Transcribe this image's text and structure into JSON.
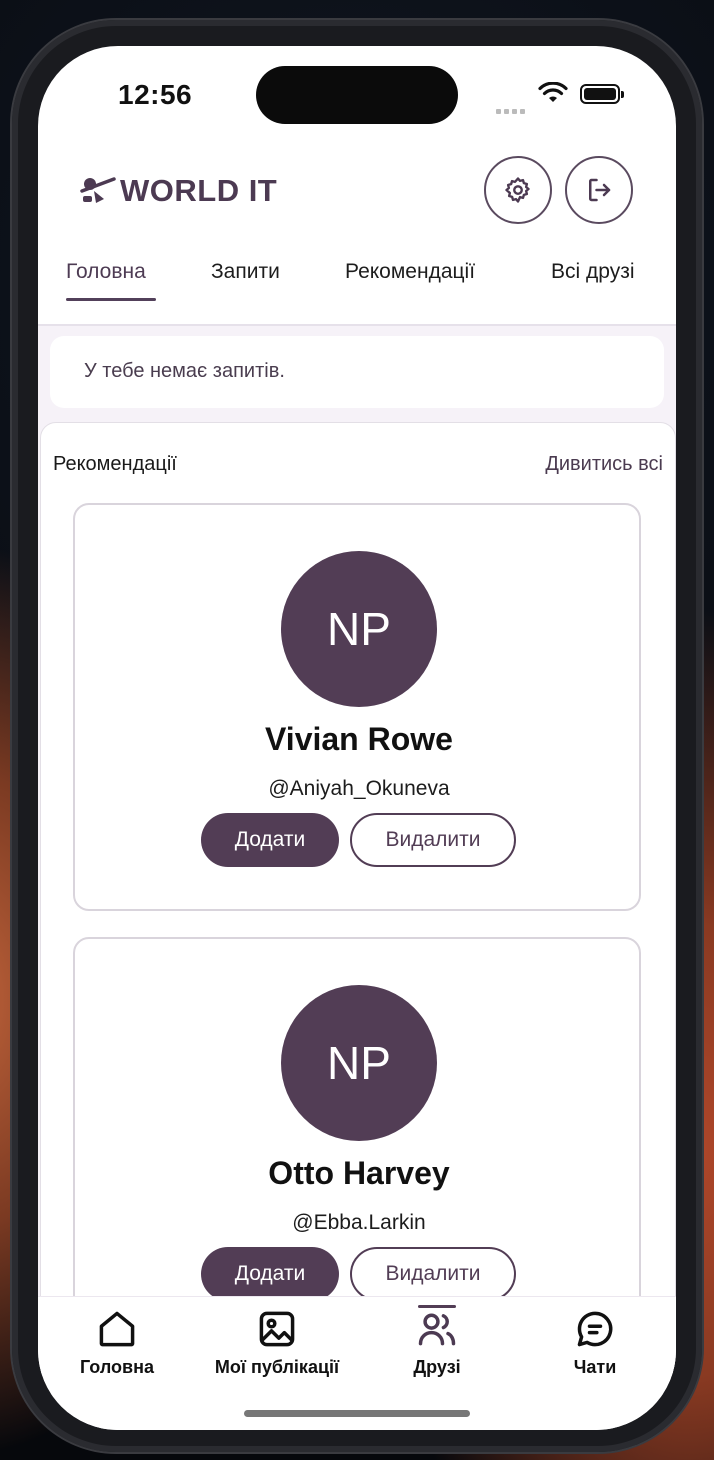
{
  "status_bar": {
    "time": "12:56"
  },
  "header": {
    "logo_text": "WORLD IT"
  },
  "tabs": [
    {
      "label": "Головна",
      "active": true
    },
    {
      "label": "Запити"
    },
    {
      "label": "Рекомендації"
    },
    {
      "label": "Всі друзі"
    }
  ],
  "requests": {
    "empty_text": "У тебе немає запитів."
  },
  "recommendations": {
    "title": "Рекомендації",
    "see_all": "Дивитись всі",
    "cards": [
      {
        "initials": "NP",
        "name": "Vivian Rowe",
        "handle": "@Aniyah_Okuneva",
        "add_label": "Додати",
        "remove_label": "Видалити"
      },
      {
        "initials": "NP",
        "name": "Otto Harvey",
        "handle": "@Ebba.Larkin",
        "add_label": "Додати",
        "remove_label": "Видалити"
      }
    ]
  },
  "bottom_nav": [
    {
      "label": "Головна",
      "icon": "home-icon"
    },
    {
      "label": "Мої публікації",
      "icon": "image-icon"
    },
    {
      "label": "Друзі",
      "icon": "friends-icon",
      "active": true
    },
    {
      "label": "Чати",
      "icon": "chat-icon"
    }
  ],
  "colors": {
    "accent": "#523d55",
    "background": "#f6f2f8"
  }
}
